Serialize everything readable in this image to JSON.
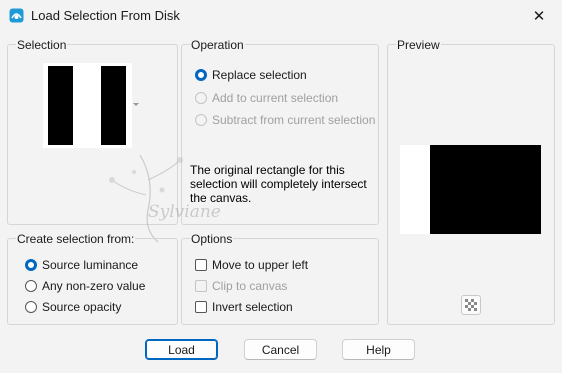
{
  "window": {
    "title": "Load Selection From Disk",
    "close_glyph": "✕"
  },
  "selection": {
    "label": "Selection"
  },
  "operation": {
    "label": "Operation",
    "options": [
      {
        "label": "Replace selection",
        "checked": true,
        "enabled": true
      },
      {
        "label": "Add to current selection",
        "checked": false,
        "enabled": false
      },
      {
        "label": "Subtract from current selection",
        "checked": false,
        "enabled": false
      }
    ],
    "info": "The original rectangle for this selection will completely intersect the canvas."
  },
  "preview": {
    "label": "Preview"
  },
  "create_from": {
    "label": "Create selection from:",
    "options": [
      {
        "label": "Source luminance",
        "checked": true
      },
      {
        "label": "Any non-zero value",
        "checked": false
      },
      {
        "label": "Source opacity",
        "checked": false
      }
    ]
  },
  "options": {
    "label": "Options",
    "items": [
      {
        "label": "Move to upper left",
        "checked": false,
        "enabled": true
      },
      {
        "label": "Clip to canvas",
        "checked": false,
        "enabled": false
      },
      {
        "label": "Invert selection",
        "checked": false,
        "enabled": true
      }
    ]
  },
  "buttons": {
    "load": "Load",
    "cancel": "Cancel",
    "help": "Help"
  },
  "watermark_text": "Sylviane",
  "colors": {
    "accent": "#0067c0",
    "background": "#f3f3f3"
  }
}
